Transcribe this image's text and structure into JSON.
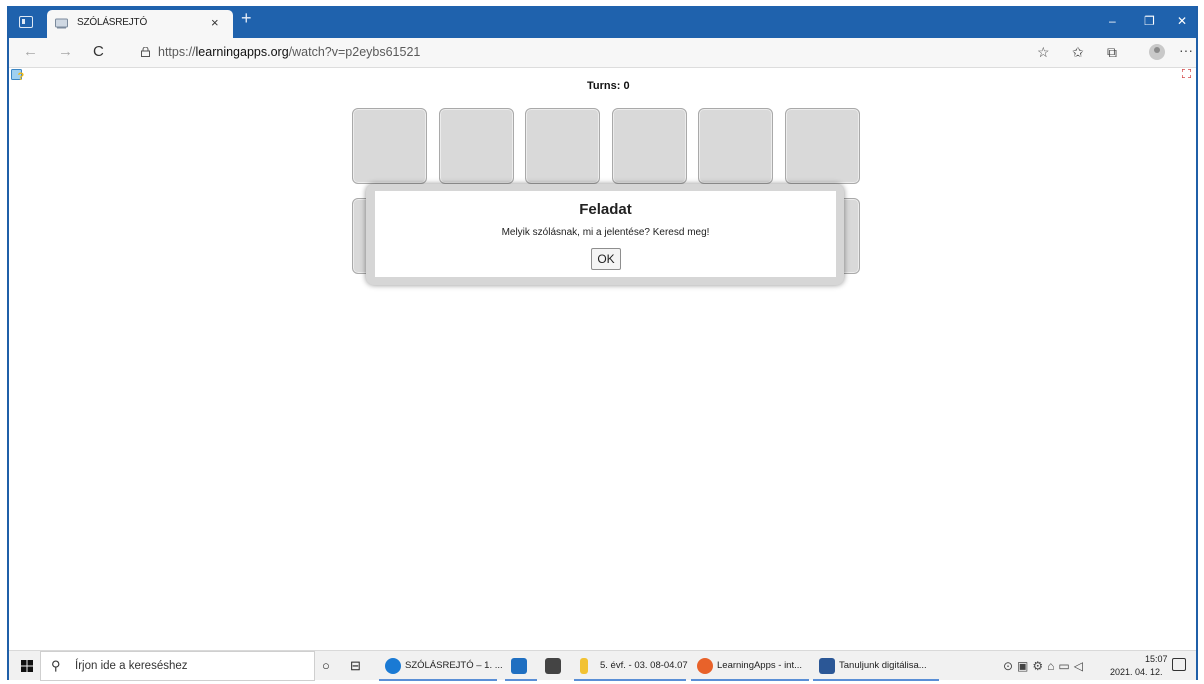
{
  "browser": {
    "tab_title": "SZÓLÁSREJTÓ",
    "tab_close": "×",
    "new_tab": "+",
    "url_prefix": "https://",
    "url_host": "learningapps.org",
    "url_path": "/watch?v=p2eybs61521",
    "window_controls": {
      "minimize": "–",
      "restore": "❐",
      "close": "✕"
    },
    "nav": {
      "back": "←",
      "forward": "→",
      "refresh": "C"
    },
    "toolbar_icons": [
      "favorites-add-icon",
      "favorites-icon",
      "collections-icon",
      "profile-icon",
      "more-icon"
    ],
    "more_label": "···"
  },
  "game": {
    "turns_label": "Turns: 0",
    "card_rows": 2,
    "cards_per_row": 6
  },
  "dialog": {
    "title": "Feladat",
    "text": "Melyik szólásnak, mi a jelentése? Keresd meg!",
    "ok_label": "OK"
  },
  "taskbar": {
    "search_placeholder": "Írjon ide a kereséshez",
    "apps": [
      {
        "label": "SZÓLÁSREJTÓ – 1. ...",
        "icon": "edge-icon",
        "color": "#1a7ad4"
      },
      {
        "label": "",
        "icon": "mail-icon",
        "color": "#1f6fc1"
      },
      {
        "label": "",
        "icon": "calculator-icon",
        "color": "#444444"
      },
      {
        "label": "5. évf. - 03. 08-04.07",
        "icon": "folder-icon",
        "color": "#f2c233"
      },
      {
        "label": "LearningApps - int...",
        "icon": "firefox-icon",
        "color": "#e8622a"
      },
      {
        "label": "Tanuljunk digitálisa...",
        "icon": "word-icon",
        "color": "#2b5796"
      }
    ],
    "clock_time": "15:07",
    "clock_date": "2021. 04. 12."
  },
  "colors": {
    "titlebar": "#1f62ad",
    "card": "#d9d9d9",
    "dialog_frame": "#d6d6d6"
  }
}
